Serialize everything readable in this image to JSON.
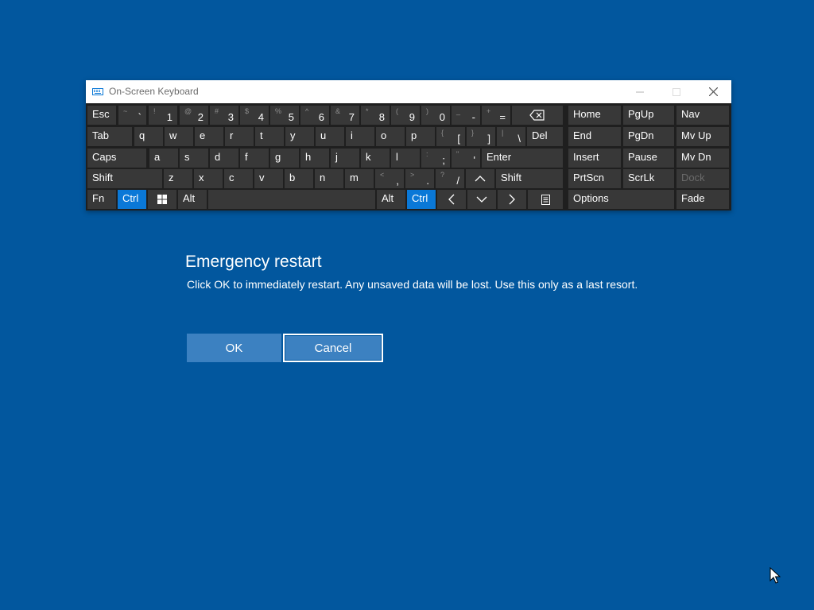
{
  "osk": {
    "title": "On-Screen Keyboard",
    "icon": "keyboard-icon",
    "window_controls": [
      "minimize-icon",
      "maximize-icon",
      "close-icon"
    ],
    "rows": [
      [
        {
          "id": "esc",
          "label": "Esc"
        },
        {
          "id": "backtick",
          "shift": "~",
          "main": "`"
        },
        {
          "id": "1",
          "shift": "!",
          "main": "1"
        },
        {
          "id": "2",
          "shift": "@",
          "main": "2"
        },
        {
          "id": "3",
          "shift": "#",
          "main": "3"
        },
        {
          "id": "4",
          "shift": "$",
          "main": "4"
        },
        {
          "id": "5",
          "shift": "%",
          "main": "5"
        },
        {
          "id": "6",
          "shift": "^",
          "main": "6"
        },
        {
          "id": "7",
          "shift": "&",
          "main": "7"
        },
        {
          "id": "8",
          "shift": "*",
          "main": "8"
        },
        {
          "id": "9",
          "shift": "(",
          "main": "9"
        },
        {
          "id": "0",
          "shift": ")",
          "main": "0"
        },
        {
          "id": "minus",
          "shift": "_",
          "main": "-"
        },
        {
          "id": "equals",
          "shift": "+",
          "main": "="
        },
        {
          "id": "backspace",
          "icon": "backspace-icon"
        },
        {
          "id": "home",
          "label": "Home"
        },
        {
          "id": "pgup",
          "label": "PgUp"
        },
        {
          "id": "nav",
          "label": "Nav"
        }
      ],
      [
        {
          "id": "tab",
          "label": "Tab"
        },
        {
          "id": "q",
          "label": "q"
        },
        {
          "id": "w",
          "label": "w"
        },
        {
          "id": "e",
          "label": "e"
        },
        {
          "id": "r",
          "label": "r"
        },
        {
          "id": "t",
          "label": "t"
        },
        {
          "id": "y",
          "label": "y"
        },
        {
          "id": "u",
          "label": "u"
        },
        {
          "id": "i",
          "label": "i"
        },
        {
          "id": "o",
          "label": "o"
        },
        {
          "id": "p",
          "label": "p"
        },
        {
          "id": "lbracket",
          "shift": "{",
          "main": "["
        },
        {
          "id": "rbracket",
          "shift": "}",
          "main": "]"
        },
        {
          "id": "backslash",
          "shift": "|",
          "main": "\\"
        },
        {
          "id": "del",
          "label": "Del"
        },
        {
          "id": "end",
          "label": "End"
        },
        {
          "id": "pgdn",
          "label": "PgDn"
        },
        {
          "id": "mvup",
          "label": "Mv Up"
        }
      ],
      [
        {
          "id": "caps",
          "label": "Caps"
        },
        {
          "id": "a",
          "label": "a"
        },
        {
          "id": "s",
          "label": "s"
        },
        {
          "id": "d",
          "label": "d"
        },
        {
          "id": "f",
          "label": "f"
        },
        {
          "id": "g",
          "label": "g"
        },
        {
          "id": "h",
          "label": "h"
        },
        {
          "id": "j",
          "label": "j"
        },
        {
          "id": "k",
          "label": "k"
        },
        {
          "id": "l",
          "label": "l"
        },
        {
          "id": "semicolon",
          "shift": ":",
          "main": ";"
        },
        {
          "id": "quote",
          "shift": "\"",
          "main": "'"
        },
        {
          "id": "enter",
          "label": "Enter"
        },
        {
          "id": "insert",
          "label": "Insert"
        },
        {
          "id": "pause",
          "label": "Pause"
        },
        {
          "id": "mvdn",
          "label": "Mv Dn"
        }
      ],
      [
        {
          "id": "lshift",
          "label": "Shift"
        },
        {
          "id": "z",
          "label": "z"
        },
        {
          "id": "x",
          "label": "x"
        },
        {
          "id": "c",
          "label": "c"
        },
        {
          "id": "v",
          "label": "v"
        },
        {
          "id": "b",
          "label": "b"
        },
        {
          "id": "n",
          "label": "n"
        },
        {
          "id": "m",
          "label": "m"
        },
        {
          "id": "comma",
          "shift": "<",
          "main": ","
        },
        {
          "id": "period",
          "shift": ">",
          "main": "."
        },
        {
          "id": "slash",
          "shift": "?",
          "main": "/"
        },
        {
          "id": "up",
          "icon": "arrow-up-icon"
        },
        {
          "id": "rshift",
          "label": "Shift"
        },
        {
          "id": "prtscn",
          "label": "PrtScn"
        },
        {
          "id": "scrlk",
          "label": "ScrLk"
        },
        {
          "id": "dock",
          "label": "Dock",
          "disabled": true
        }
      ],
      [
        {
          "id": "fn",
          "label": "Fn"
        },
        {
          "id": "lctrl",
          "label": "Ctrl",
          "active": true
        },
        {
          "id": "win",
          "icon": "windows-logo-icon"
        },
        {
          "id": "lalt",
          "label": "Alt"
        },
        {
          "id": "space",
          "label": ""
        },
        {
          "id": "ralt",
          "label": "Alt"
        },
        {
          "id": "rctrl",
          "label": "Ctrl",
          "active": true
        },
        {
          "id": "left",
          "icon": "arrow-left-icon"
        },
        {
          "id": "down",
          "icon": "arrow-down-icon"
        },
        {
          "id": "right",
          "icon": "arrow-right-icon"
        },
        {
          "id": "menu",
          "icon": "context-menu-icon"
        },
        {
          "id": "options",
          "label": "Options"
        },
        {
          "id": "fade",
          "label": "Fade"
        }
      ]
    ]
  },
  "dialog": {
    "title": "Emergency restart",
    "message": "Click OK to immediately restart. Any unsaved data will be lost. Use this only as a last resort.",
    "ok_label": "OK",
    "cancel_label": "Cancel"
  },
  "colors": {
    "desktop": "#02579e",
    "key": "#383838",
    "key_active": "#0a78d7",
    "button": "#3c81c1"
  }
}
